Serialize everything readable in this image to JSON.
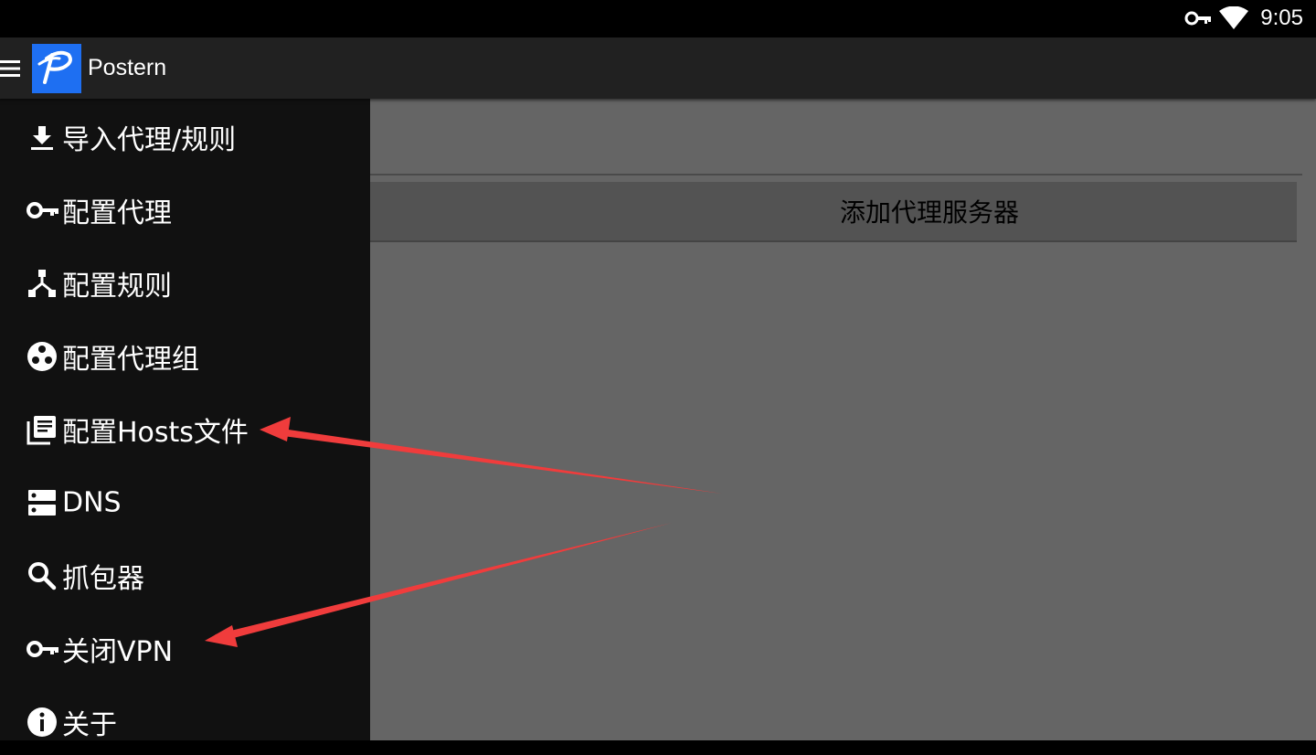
{
  "status_bar": {
    "time": "9:05",
    "icons": [
      "vpn-key-icon",
      "wifi-icon"
    ]
  },
  "app_bar": {
    "title": "Postern",
    "menu_icon": "hamburger-menu-icon",
    "logo_icon": "postern-logo-icon"
  },
  "main": {
    "add_proxy_button_label": "添加代理服务器"
  },
  "drawer": {
    "items": [
      {
        "label": "导入代理/规则",
        "icon": "download-icon"
      },
      {
        "label": "配置代理",
        "icon": "key-icon"
      },
      {
        "label": "配置规则",
        "icon": "network-share-icon"
      },
      {
        "label": "配置代理组",
        "icon": "group-circles-icon"
      },
      {
        "label": "配置Hosts文件",
        "icon": "library-books-icon"
      },
      {
        "label": "DNS",
        "icon": "dns-server-icon"
      },
      {
        "label": "抓包器",
        "icon": "search-icon"
      },
      {
        "label": "关闭VPN",
        "icon": "key-icon"
      },
      {
        "label": "关于",
        "icon": "info-icon"
      }
    ]
  },
  "colors": {
    "drawer_bg": "#111111",
    "app_bar_bg": "#212121",
    "content_bg": "#656565",
    "logo_bg": "#1e6ff2",
    "annotation_arrow": "#f03c3c"
  }
}
